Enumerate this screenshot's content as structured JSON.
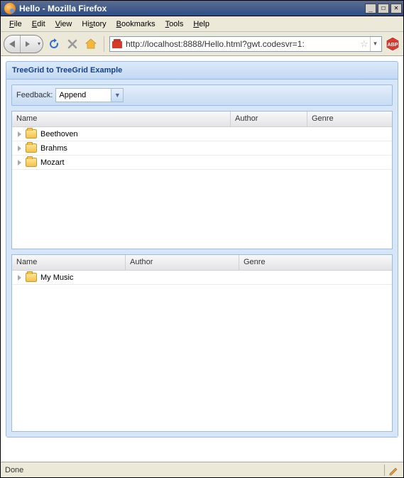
{
  "window": {
    "title": "Hello - Mozilla Firefox"
  },
  "menubar": {
    "file": "File",
    "edit": "Edit",
    "view": "View",
    "history": "History",
    "bookmarks": "Bookmarks",
    "tools": "Tools",
    "help": "Help"
  },
  "url": "http://localhost:8888/Hello.html?gwt.codesvr=1:",
  "panel": {
    "title": "TreeGrid to TreeGrid Example"
  },
  "feedback": {
    "label": "Feedback:",
    "value": "Append"
  },
  "grid1": {
    "cols": {
      "name": "Name",
      "author": "Author",
      "genre": "Genre"
    },
    "rows": [
      {
        "name": "Beethoven"
      },
      {
        "name": "Brahms"
      },
      {
        "name": "Mozart"
      }
    ]
  },
  "grid2": {
    "cols": {
      "name": "Name",
      "author": "Author",
      "genre": "Genre"
    },
    "rows": [
      {
        "name": "My Music"
      }
    ]
  },
  "status": {
    "text": "Done"
  }
}
